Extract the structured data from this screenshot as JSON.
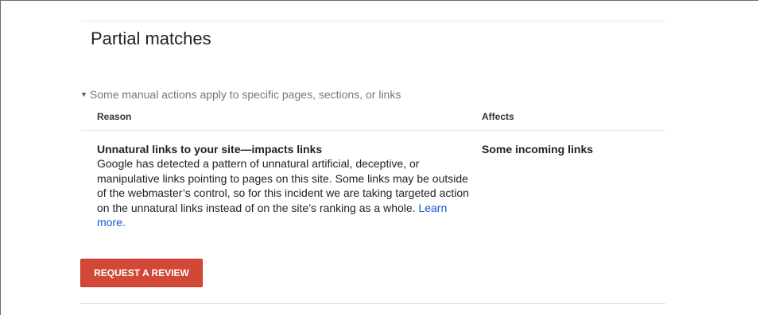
{
  "section": {
    "title": "Partial matches",
    "disclosure_text": "Some manual actions apply to specific pages, sections, or links"
  },
  "table": {
    "columns": [
      "Reason",
      "Affects"
    ],
    "rows": [
      {
        "reason_title": "Unnatural links to your site—impacts links",
        "reason_description": "Google has detected a pattern of unnatural artificial, deceptive, or manipulative links pointing to pages on this site. Some links may be outside of the webmaster’s control, so for this incident we are taking targeted action on the unnatural links instead of on the site’s ranking as a whole.",
        "learn_more": "Learn more.",
        "affects": "Some incoming links"
      }
    ]
  },
  "actions": {
    "request_review_label": "REQUEST A REVIEW"
  },
  "colors": {
    "button_background": "#d14836",
    "link": "#1155cc",
    "muted_text": "#777777"
  }
}
